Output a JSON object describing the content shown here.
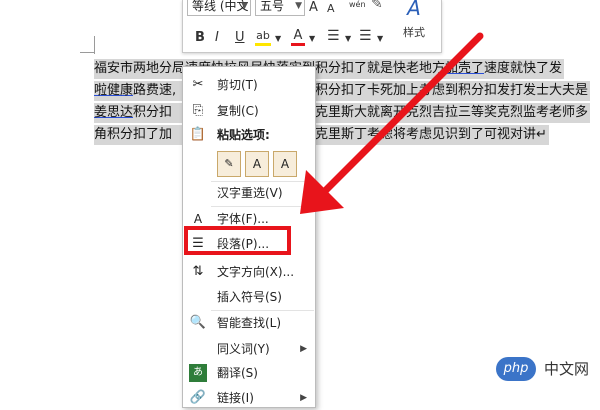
{
  "mini_toolbar": {
    "font_name": "等线 (中文",
    "font_size": "五号",
    "grow_font": "A",
    "shrink_font": "A",
    "phonetic": "wén",
    "bold": "B",
    "italic": "I",
    "underline": "U",
    "highlight": "ab",
    "font_color": "A",
    "styles_label": "样式"
  },
  "document": {
    "lines": [
      {
        "pre": "福安市两地分局速度快拉风尽快落实到积分扣了就是快老地方",
        "u": "加壳了",
        "post": "速度就快了发"
      },
      {
        "pre": "",
        "u": "啦健康",
        "post": "路费速,",
        "tail": "积分扣了卡死加上考虑到积分扣发打发士大夫是"
      },
      {
        "pre": "",
        "u": "姜思达",
        "post": "积分扣",
        "tail": "克里斯大就离开克烈吉拉三等奖克烈监考老师多"
      },
      {
        "pre": "角积分扣了加",
        "u": "",
        "post": "",
        "tail": "克里斯丁考虑将考虑见识到了可视对讲↵"
      }
    ]
  },
  "context_menu": {
    "items": [
      {
        "label": "剪切(T)",
        "icon": "scissors-icon"
      },
      {
        "label": "复制(C)",
        "icon": "copy-icon"
      },
      {
        "label": "粘贴选项:",
        "icon": "paste-icon"
      },
      {
        "label": "汉字重选(V)",
        "icon": ""
      },
      {
        "label": "字体(F)...",
        "icon": "font-icon"
      },
      {
        "label": "段落(P)...",
        "icon": "paragraph-icon"
      },
      {
        "label": "文字方向(X)...",
        "icon": "text-direction-icon"
      },
      {
        "label": "插入符号(S)",
        "icon": ""
      },
      {
        "label": "智能查找(L)",
        "icon": "smart-lookup-icon"
      },
      {
        "label": "同义词(Y)",
        "icon": ""
      },
      {
        "label": "翻译(S)",
        "icon": "translate-icon"
      },
      {
        "label": "链接(I)",
        "icon": "link-icon"
      }
    ],
    "paste_option_glyphs": [
      "A",
      "A"
    ]
  },
  "watermark": {
    "logo_text": "php",
    "text": "中文网"
  },
  "colors": {
    "highlight_box": "#e8141b",
    "arrow": "#e8141b",
    "selection": "#d6d6d6"
  }
}
